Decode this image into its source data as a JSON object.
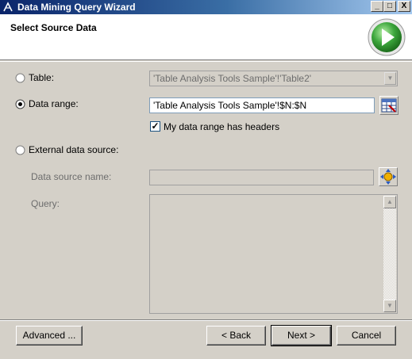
{
  "window": {
    "title": "Data Mining Query Wizard",
    "controls": {
      "minimize": "_",
      "maximize": "□",
      "close": "X"
    }
  },
  "header": {
    "title": "Select Source Data",
    "graphic_icon": "green-play-arrow-icon"
  },
  "source_options": {
    "table": {
      "label": "Table:",
      "selected": false,
      "value": "'Table Analysis Tools Sample'!'Table2'",
      "enabled": false
    },
    "data_range": {
      "label": "Data range:",
      "selected": true,
      "value": "'Table Analysis Tools Sample'!$N:$N",
      "picker_icon": "range-selector-icon",
      "headers_checkbox": {
        "label": "My data range has headers",
        "checked": true,
        "mark": "✓"
      }
    },
    "external": {
      "label": "External data source:",
      "selected": false,
      "data_source_label": "Data source name:",
      "data_source_value": "",
      "browse_icon": "data-source-browse-icon",
      "query_label": "Query:",
      "query_value": ""
    }
  },
  "footer": {
    "advanced_label": "Advanced ...",
    "back_label": "< Back",
    "next_label": "Next >",
    "cancel_label": "Cancel"
  },
  "colors": {
    "titlebar_start": "#0a246a",
    "titlebar_end": "#a6caf0",
    "dialog_bg": "#d4d0c8",
    "play_green": "#3ca63c"
  }
}
